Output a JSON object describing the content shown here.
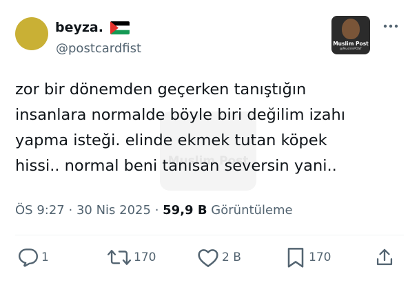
{
  "author": {
    "display_name": "beyza.",
    "flag": "palestine-flag",
    "handle": "@postcardfist",
    "avatar_color": "#c9b035"
  },
  "badge": {
    "brand": "Muslim Post",
    "sub": "@MuslimPOST"
  },
  "watermark": {
    "text": "Muslim Post"
  },
  "tweet": {
    "text": "zor bir dönemden geçerken tanıştığın\ninsanlara normalde böyle biri değilim izahı\nyapma isteği. elinde ekmek tutan köpek\nhissi.. normal beni tanısan seversin yani.."
  },
  "meta": {
    "time": "ÖS 9:27",
    "separator": "·",
    "date": "30 Nis 2025",
    "views_count": "59,9 B",
    "views_label": "Görüntüleme"
  },
  "actions": {
    "reply_count": "1",
    "retweet_count": "170",
    "like_count": "2 B",
    "bookmark_count": "170"
  },
  "colors": {
    "text": "#0f1419",
    "secondary": "#536471",
    "divider": "#eff3f4"
  }
}
